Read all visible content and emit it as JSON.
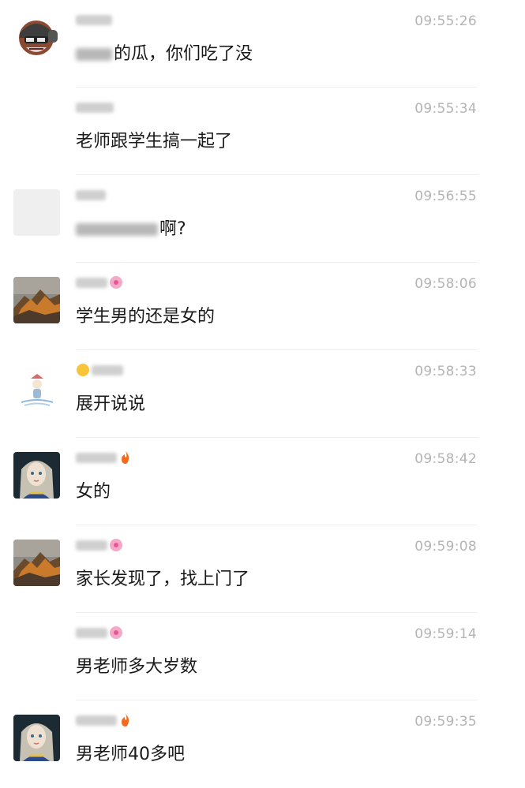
{
  "messages": [
    {
      "time": "09:55:26",
      "text": "的瓜，你们吃了没",
      "redacted_prefix": true,
      "avatar": "soldier-avatar"
    },
    {
      "time": "09:55:34",
      "text": "老师跟学生搞一起了",
      "redacted_prefix": false,
      "avatar": "none"
    },
    {
      "time": "09:56:55",
      "text": "啊?",
      "redacted_prefix": true,
      "avatar": "blank-avatar"
    },
    {
      "time": "09:58:06",
      "text": "学生男的还是女的",
      "redacted_prefix": false,
      "avatar": "mountain-avatar"
    },
    {
      "time": "09:58:33",
      "text": "展开说说",
      "redacted_prefix": false,
      "avatar": "cartoon-avatar"
    },
    {
      "time": "09:58:42",
      "text": "女的",
      "redacted_prefix": false,
      "avatar": "girl-avatar"
    },
    {
      "time": "09:59:08",
      "text": "家长发现了，找上门了",
      "redacted_prefix": false,
      "avatar": "mountain-avatar"
    },
    {
      "time": "09:59:14",
      "text": "男老师多大岁数",
      "redacted_prefix": false,
      "avatar": "none"
    },
    {
      "time": "09:59:35",
      "text": "男老师40多吧",
      "redacted_prefix": false,
      "avatar": "girl-avatar"
    }
  ],
  "colors": {
    "time": "#b4b4b4",
    "text": "#1a1a1a",
    "divider": "#eeeeee"
  }
}
